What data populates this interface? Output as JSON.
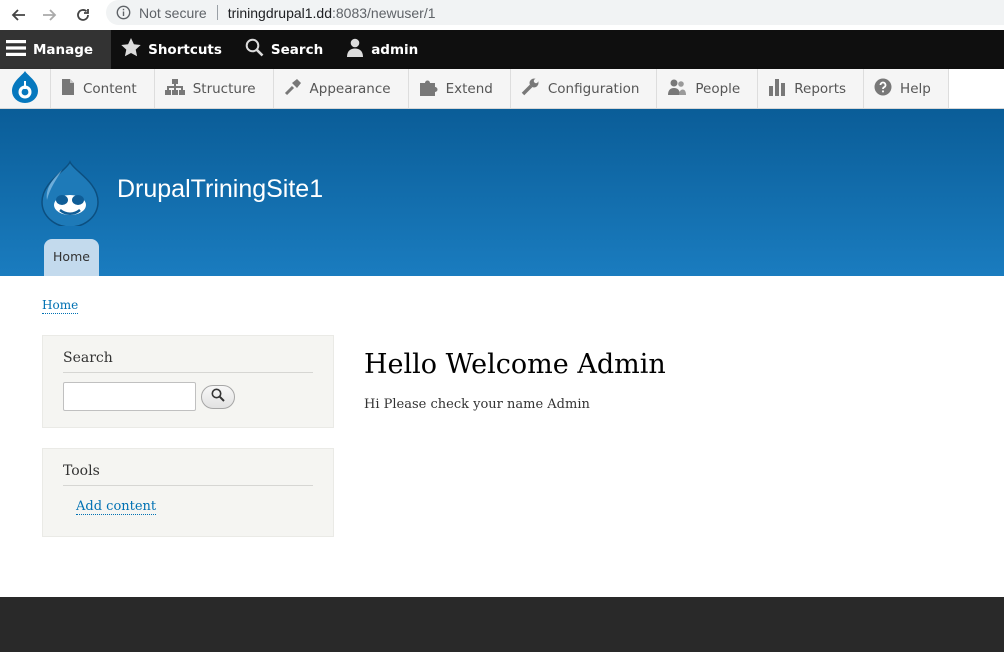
{
  "browser": {
    "security_label": "Not secure",
    "url_host": "triningdrupal1.dd",
    "url_path": ":8083/newuser/1"
  },
  "toolbar": {
    "manage_label": "Manage",
    "shortcuts_label": "Shortcuts",
    "search_label": "Search",
    "user_label": "admin"
  },
  "tray": {
    "items": [
      {
        "label": "Content",
        "icon": "file-icon"
      },
      {
        "label": "Structure",
        "icon": "sitemap-icon"
      },
      {
        "label": "Appearance",
        "icon": "brush-icon"
      },
      {
        "label": "Extend",
        "icon": "puzzle-icon"
      },
      {
        "label": "Configuration",
        "icon": "wrench-icon"
      },
      {
        "label": "People",
        "icon": "people-icon"
      },
      {
        "label": "Reports",
        "icon": "bar-chart-icon"
      },
      {
        "label": "Help",
        "icon": "help-icon"
      }
    ]
  },
  "header": {
    "site_name": "DrupalTriningSite1",
    "nav_home": "Home"
  },
  "breadcrumb": {
    "home": "Home"
  },
  "sidebar": {
    "search_title": "Search",
    "tools_title": "Tools",
    "tools_link": "Add content"
  },
  "main": {
    "title": "Hello Welcome Admin",
    "body": "Hi Please check your name Admin"
  },
  "colors": {
    "header_top": "#0a5d98",
    "header_bottom": "#1a7cbf",
    "link": "#0071b3",
    "toolbar": "#0f0f0f",
    "footer": "#292929"
  }
}
